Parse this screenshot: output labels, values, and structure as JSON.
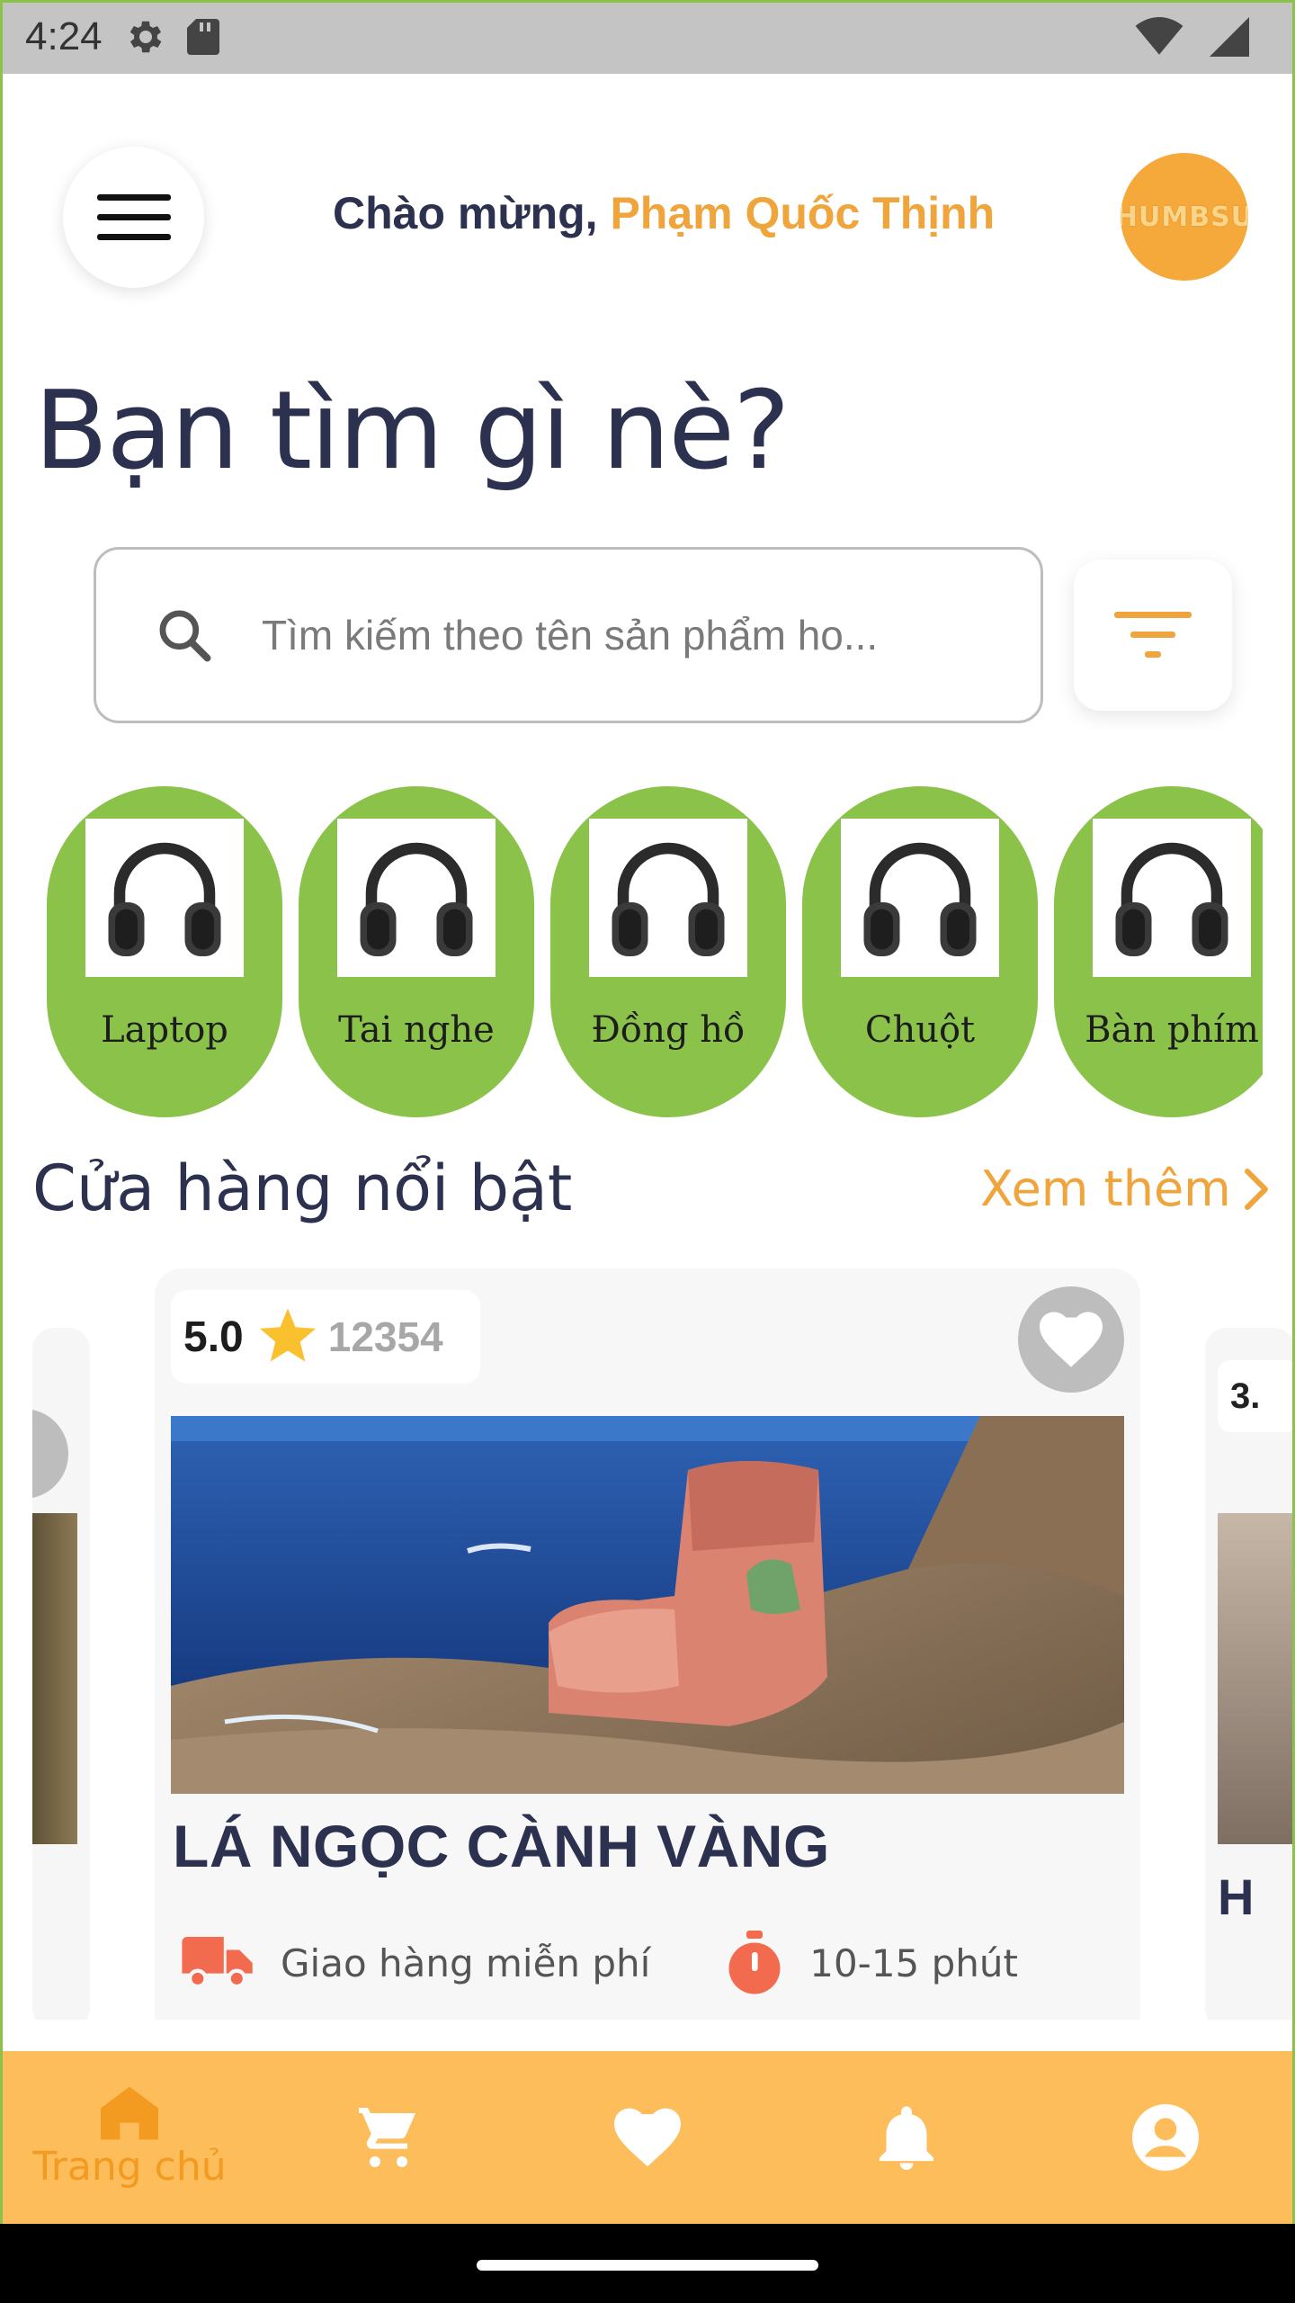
{
  "status_bar": {
    "time": "4:24"
  },
  "header": {
    "greeting_prefix": "Chào mừng, ",
    "user_name": "Phạm Quốc Thịnh",
    "avatar_logo": "HUMBSU"
  },
  "headline": "Bạn tìm gì nè?",
  "search": {
    "placeholder": "Tìm kiếm theo tên sản phẩm ho..."
  },
  "categories": [
    {
      "label": "Laptop"
    },
    {
      "label": "Tai nghe"
    },
    {
      "label": "Đồng hồ"
    },
    {
      "label": "Chuột"
    },
    {
      "label": "Bàn phím"
    }
  ],
  "featured": {
    "title": "Cửa hàng nổi bật",
    "see_more": "Xem thêm"
  },
  "shop_card": {
    "rating": "5.0",
    "reviews": "12354",
    "name": "LÁ NGỌC CÀNH VÀNG",
    "delivery": "Giao hàng miễn phí",
    "time": "10-15 phút"
  },
  "shop_card_next": {
    "rating_partial": "3.",
    "name_partial": "H"
  },
  "bottom_nav": {
    "home_label": "Trang chủ",
    "active_color": "#f39a21",
    "bar_color": "#fcbd5a"
  },
  "colors": {
    "accent": "#f0a43c",
    "category_bg": "#8bc34a",
    "text_dark": "#2c3150"
  }
}
